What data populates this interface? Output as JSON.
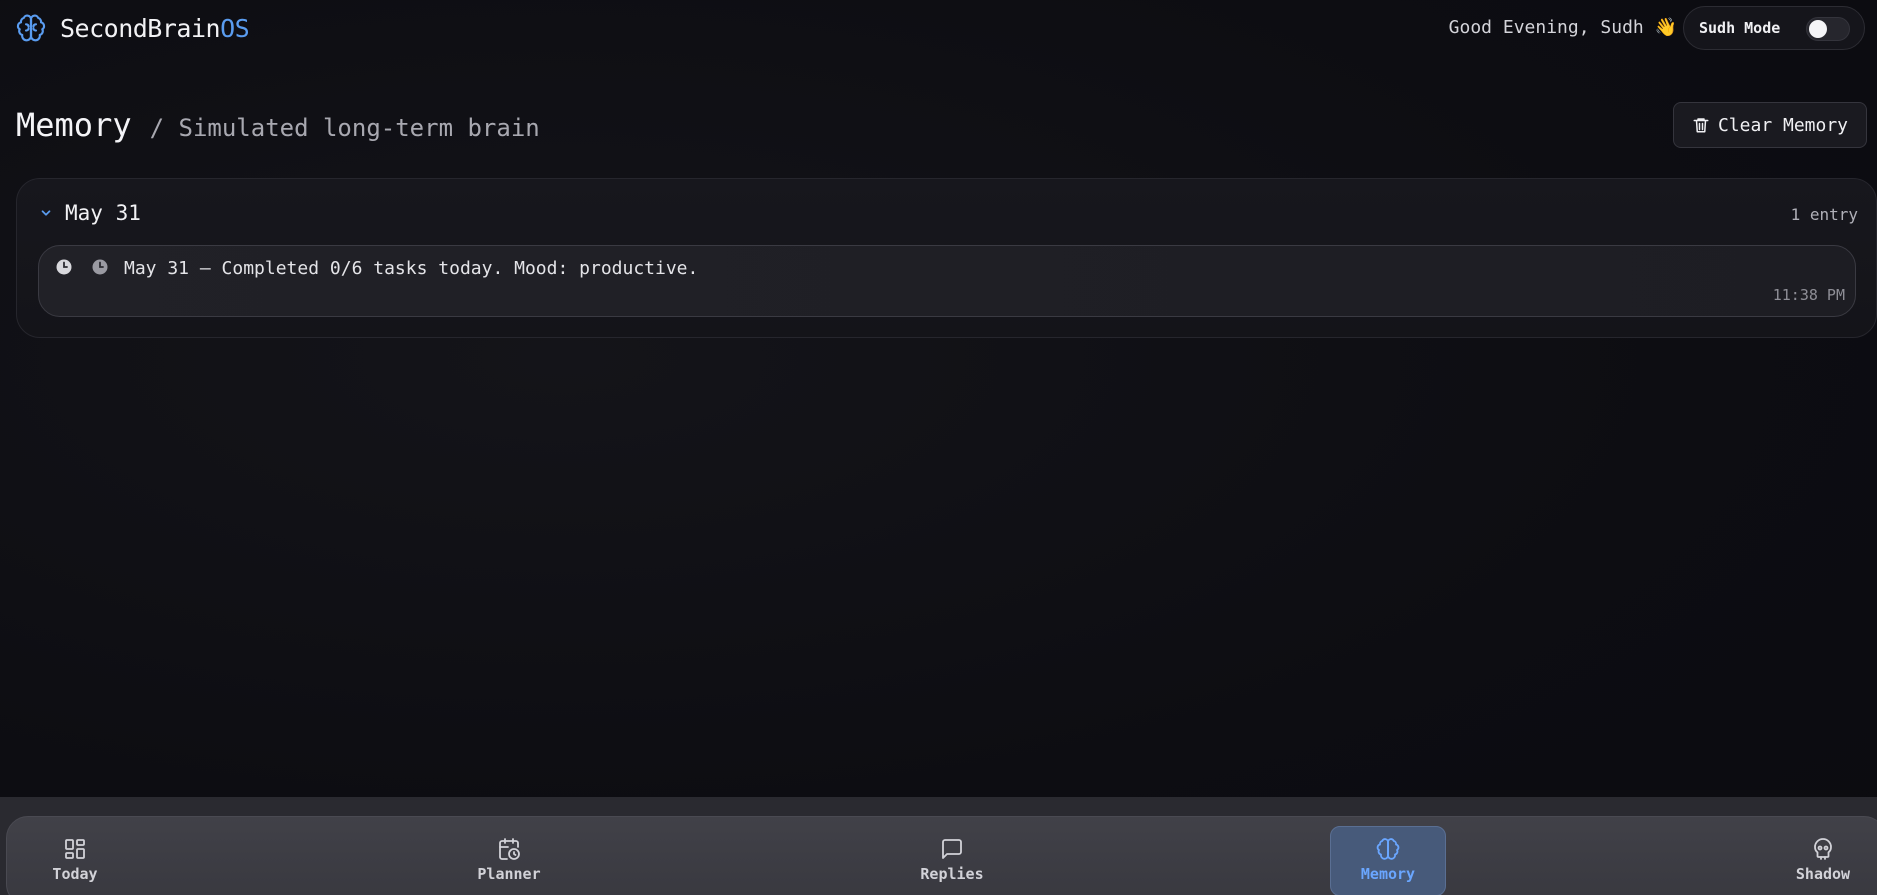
{
  "header": {
    "logo_text": "SecondBrain",
    "logo_accent": "OS",
    "greeting": "Good Evening, Sudh 👋",
    "mode_label": "Sudh Mode",
    "mode_on": false
  },
  "page": {
    "title": "Memory",
    "subtitle": "/ Simulated long-term brain",
    "clear_button": "Clear Memory"
  },
  "groups": [
    {
      "date": "May 31",
      "count": "1 entry",
      "entries": [
        {
          "text": "May 31 – Completed 0/6 tasks today. Mood: productive.",
          "time": "11:38 PM"
        }
      ]
    }
  ],
  "nav": {
    "items": [
      {
        "label": "Today",
        "icon": "grid-icon"
      },
      {
        "label": "Planner",
        "icon": "calendar-clock-icon"
      },
      {
        "label": "Replies",
        "icon": "chat-bubble-icon"
      },
      {
        "label": "Memory",
        "icon": "brain-icon",
        "active": true
      },
      {
        "label": "Shadow",
        "icon": "skull-icon"
      }
    ]
  },
  "colors": {
    "accent": "#5a9cf0",
    "background": "#0d0d12",
    "active_nav": "#475a7a"
  }
}
